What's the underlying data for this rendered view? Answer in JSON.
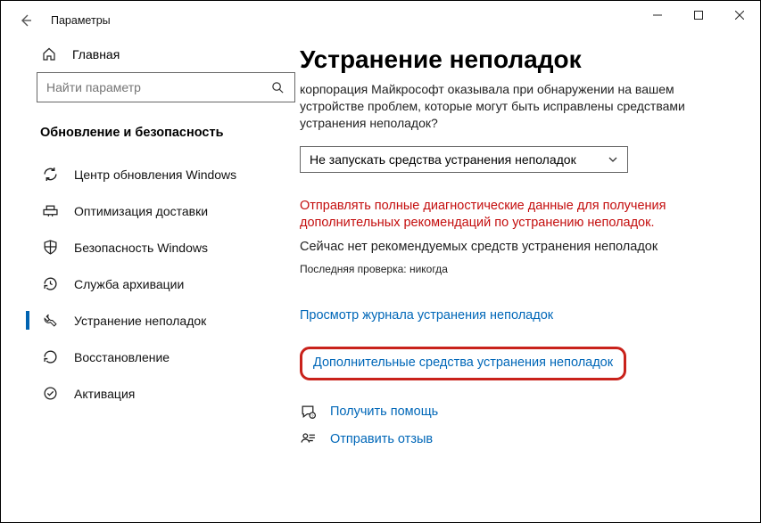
{
  "window": {
    "title": "Параметры"
  },
  "sidebar": {
    "home": "Главная",
    "search_placeholder": "Найти параметр",
    "section": "Обновление и безопасность",
    "items": [
      {
        "label": "Центр обновления Windows"
      },
      {
        "label": "Оптимизация доставки"
      },
      {
        "label": "Безопасность Windows"
      },
      {
        "label": "Служба архивации"
      },
      {
        "label": "Устранение неполадок"
      },
      {
        "label": "Восстановление"
      },
      {
        "label": "Активация"
      }
    ]
  },
  "main": {
    "heading": "Устранение неполадок",
    "intro": "корпорация Майкрософт оказывала при обнаружении на вашем устройстве проблем, которые могут быть исправлены средствами устранения неполадок?",
    "dropdown_value": "Не запускать средства устранения неполадок",
    "warn": "Отправлять полные диагностические данные для получения дополнительных рекомендаций по устранению неполадок.",
    "info": "Сейчас нет рекомендуемых средств устранения неполадок",
    "meta": "Последняя проверка: никогда",
    "link_history": "Просмотр журнала устранения неполадок",
    "link_more": "Дополнительные средства устранения неполадок",
    "help": "Получить помощь",
    "feedback": "Отправить отзыв"
  }
}
